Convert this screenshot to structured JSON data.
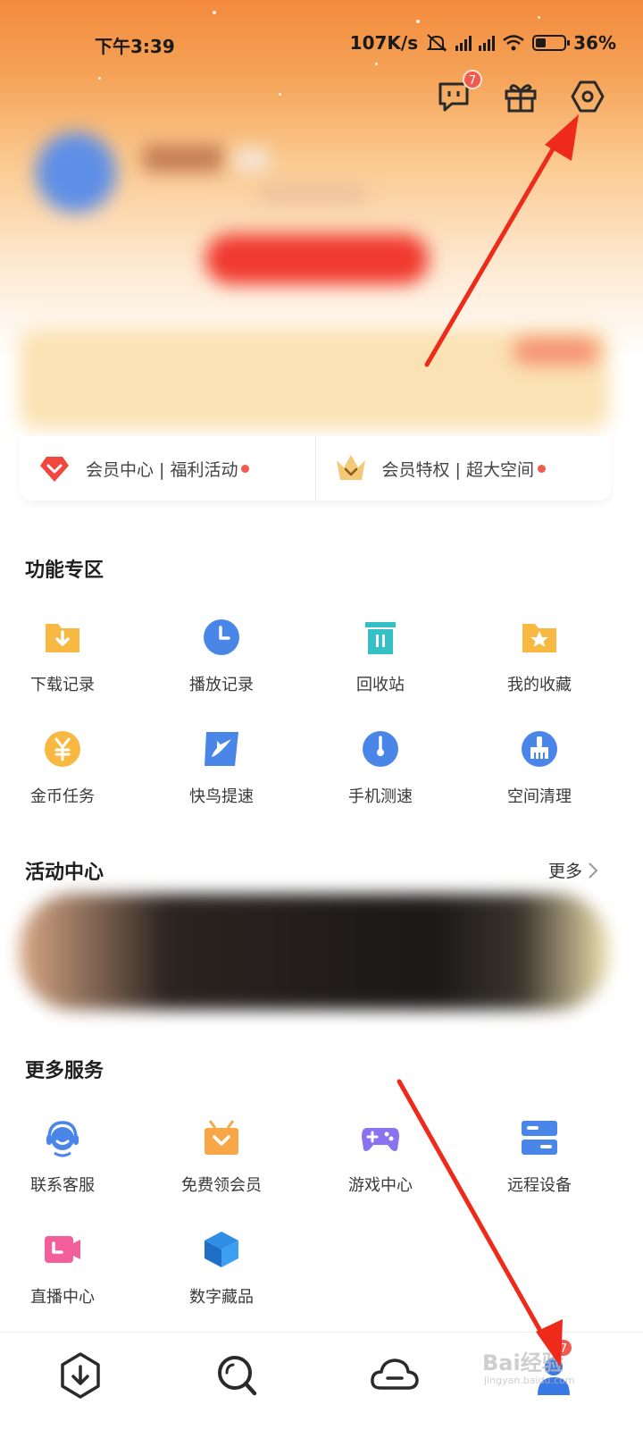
{
  "status": {
    "time": "下午3:39",
    "net_speed": "107K/s",
    "battery": "36%"
  },
  "header": {
    "message_badge": "7"
  },
  "member_row": {
    "left_label": "会员中心 | 福利活动",
    "right_label": "会员特权 | 超大空间"
  },
  "features": {
    "title": "功能专区",
    "items": [
      {
        "label": "下载记录",
        "icon": "download-folder-icon"
      },
      {
        "label": "播放记录",
        "icon": "clock-icon"
      },
      {
        "label": "回收站",
        "icon": "trash-icon"
      },
      {
        "label": "我的收藏",
        "icon": "star-folder-icon"
      },
      {
        "label": "金币任务",
        "icon": "coin-icon"
      },
      {
        "label": "快鸟提速",
        "icon": "bird-icon"
      },
      {
        "label": "手机测速",
        "icon": "speedometer-icon"
      },
      {
        "label": "空间清理",
        "icon": "broom-icon"
      }
    ]
  },
  "activity": {
    "title": "活动中心",
    "more": "更多"
  },
  "services": {
    "title": "更多服务",
    "items": [
      {
        "label": "联系客服",
        "icon": "support-icon"
      },
      {
        "label": "免费领会员",
        "icon": "gift-box-icon"
      },
      {
        "label": "游戏中心",
        "icon": "gamepad-icon"
      },
      {
        "label": "远程设备",
        "icon": "server-icon"
      },
      {
        "label": "直播中心",
        "icon": "live-camera-icon"
      },
      {
        "label": "数字藏品",
        "icon": "cube-icon"
      }
    ]
  },
  "bottom_nav": {
    "badge": "7",
    "tabs": [
      {
        "icon": "download-tab-icon"
      },
      {
        "icon": "search-tab-icon"
      },
      {
        "icon": "cloud-tab-icon"
      },
      {
        "icon": "profile-tab-icon"
      }
    ]
  },
  "watermark": {
    "text": "Bai经验",
    "sub": "jingyan.baidu.com"
  },
  "colors": {
    "accent_red": "#f25a4f",
    "hero_orange": "#f38a3c",
    "icon_blue": "#4a86e8",
    "icon_yellow": "#f7b941",
    "arrow_red": "#ee2a1b"
  }
}
